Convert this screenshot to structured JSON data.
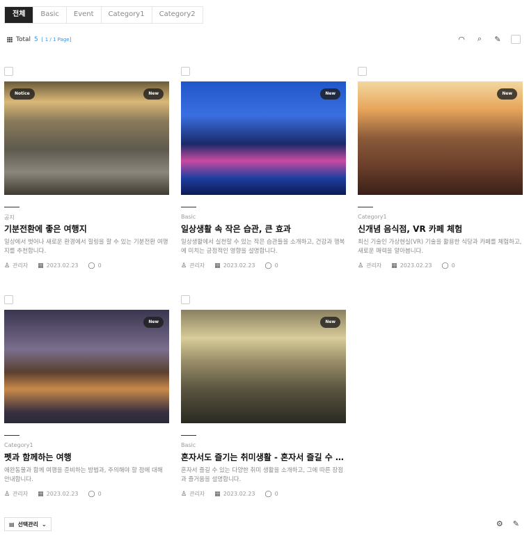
{
  "tabs": [
    {
      "label": "전체"
    },
    {
      "label": "Basic"
    },
    {
      "label": "Event"
    },
    {
      "label": "Category1"
    },
    {
      "label": "Category2"
    }
  ],
  "summary": {
    "label": "Total",
    "count": "5",
    "page": "[ 1 / 1 Page]"
  },
  "posts": [
    {
      "badge_left": "Notice",
      "badge_right": "New",
      "category": "공지",
      "title": "기분전환에 좋은 여행지",
      "desc": "일상에서 벗어나 새로운 환경에서 힐링을 할 수 있는 기분전환 여행지를 추천합니다.",
      "author": "관리자",
      "date": "2023.02.23",
      "comments": "0"
    },
    {
      "badge_right": "New",
      "category": "Basic",
      "title": "일상생활 속 작은 습관, 큰 효과",
      "desc": " 일상생활에서 실천할 수 있는 작은 습관들을 소개하고, 건강과 행복에 미치는 긍정적인 영향을 설명합니다.",
      "author": "관리자",
      "date": "2023.02.23",
      "comments": "0"
    },
    {
      "badge_right": "New",
      "category": "Category1",
      "title": "신개념 음식점, VR 카페 체험",
      "desc": "최신 기술인 가상현실(VR) 기술을 활용한 식당과 카페를 체험하고, 새로운 매력을 알아봅니다.",
      "author": "관리자",
      "date": "2023.02.23",
      "comments": "0"
    },
    {
      "badge_right": "New",
      "category": "Category1",
      "title": "펫과 함께하는 여행",
      "desc": "애완동물과 함께 여행을 준비하는 방법과, 주의해야 할 점에 대해 안내합니다.",
      "author": "관리자",
      "date": "2023.02.23",
      "comments": "0"
    },
    {
      "badge_right": "New",
      "category": "Basic",
      "title": "혼자서도 즐기는 취미생활 - 혼자서 즐길 수 있는 취미",
      "desc": "혼자서 즐길 수 있는 다양한 취미 생활을 소개하고, 그에 따른 장점과 즐거움을 설명합니다.",
      "author": "관리자",
      "date": "2023.02.23",
      "comments": "0"
    }
  ],
  "bottom": {
    "manage_label": "선택관리"
  }
}
